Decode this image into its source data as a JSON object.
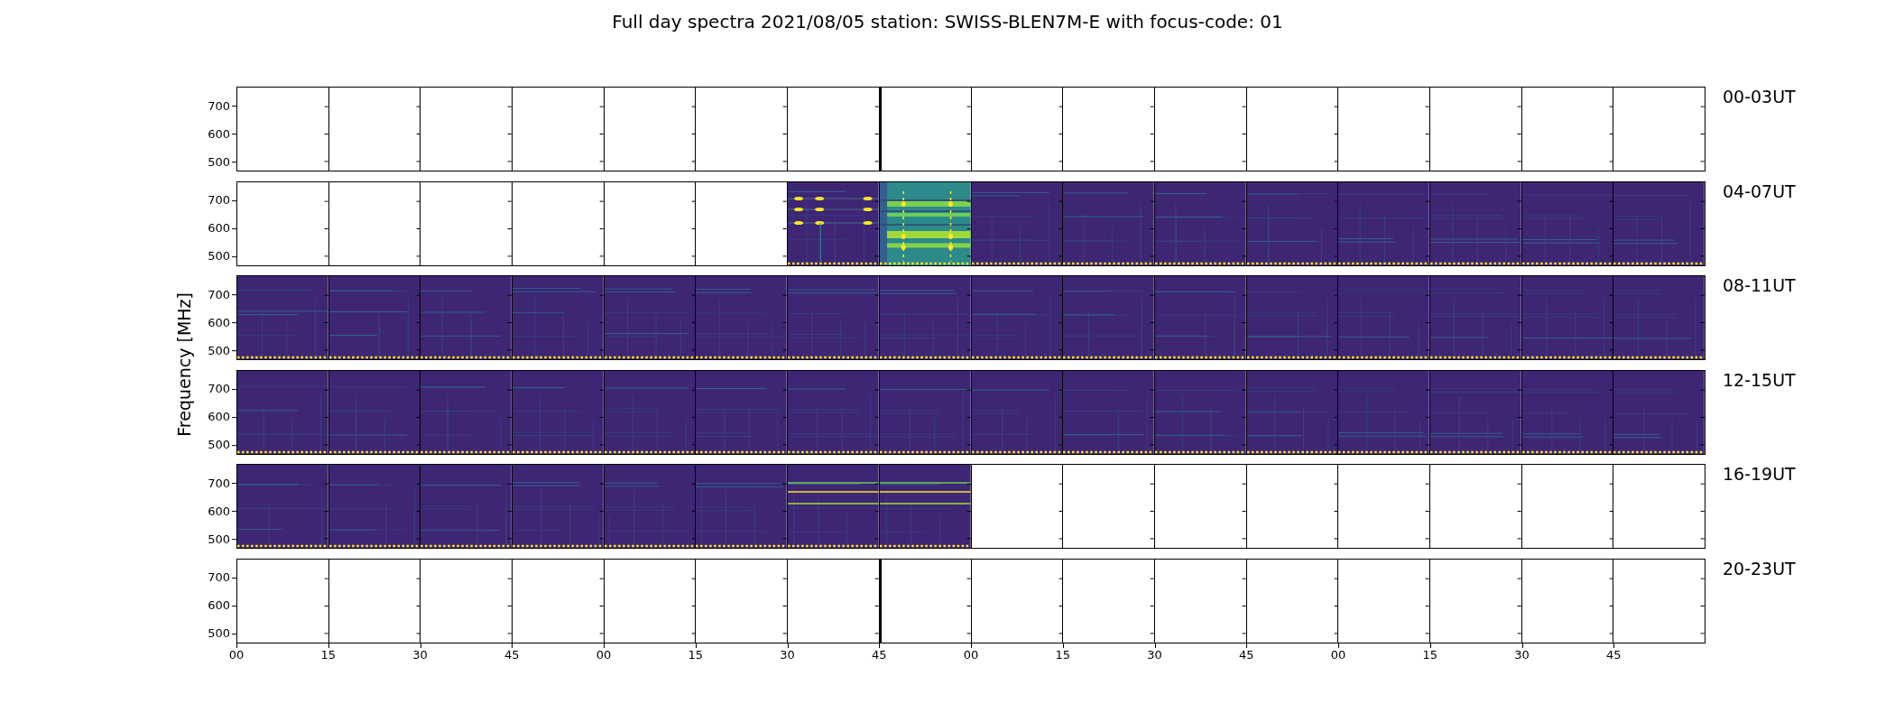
{
  "title": "Full day spectra 2021/08/05 station: SWISS-BLEN7M-E with focus-code: 01",
  "y_axis_label": "Frequency [MHz]",
  "rows": [
    {
      "label": "00-03UT",
      "yticks": [
        "700",
        "600",
        "500"
      ],
      "panels": [
        {
          "kind": "empty"
        },
        {
          "kind": "empty"
        },
        {
          "kind": "empty"
        },
        {
          "kind": "empty"
        },
        {
          "kind": "empty"
        },
        {
          "kind": "empty"
        },
        {
          "kind": "empty"
        },
        {
          "kind": "empty_marked"
        },
        {
          "kind": "empty"
        },
        {
          "kind": "empty"
        },
        {
          "kind": "empty"
        },
        {
          "kind": "empty"
        },
        {
          "kind": "empty"
        },
        {
          "kind": "empty"
        },
        {
          "kind": "empty"
        },
        {
          "kind": "empty"
        }
      ]
    },
    {
      "label": "04-07UT",
      "yticks": [
        "700",
        "600",
        "500"
      ],
      "panels": [
        {
          "kind": "empty"
        },
        {
          "kind": "empty"
        },
        {
          "kind": "empty"
        },
        {
          "kind": "empty"
        },
        {
          "kind": "empty"
        },
        {
          "kind": "empty"
        },
        {
          "kind": "bursts"
        },
        {
          "kind": "bright"
        },
        {
          "kind": "spectrum"
        },
        {
          "kind": "spectrum"
        },
        {
          "kind": "spectrum"
        },
        {
          "kind": "spectrum"
        },
        {
          "kind": "spectrum"
        },
        {
          "kind": "spectrum"
        },
        {
          "kind": "spectrum"
        },
        {
          "kind": "spectrum"
        }
      ]
    },
    {
      "label": "08-11UT",
      "yticks": [
        "700",
        "600",
        "500"
      ],
      "panels": [
        {
          "kind": "spectrum"
        },
        {
          "kind": "spectrum"
        },
        {
          "kind": "spectrum"
        },
        {
          "kind": "spectrum"
        },
        {
          "kind": "spectrum"
        },
        {
          "kind": "spectrum"
        },
        {
          "kind": "spectrum"
        },
        {
          "kind": "spectrum"
        },
        {
          "kind": "spectrum"
        },
        {
          "kind": "spectrum"
        },
        {
          "kind": "spectrum"
        },
        {
          "kind": "spectrum"
        },
        {
          "kind": "spectrum"
        },
        {
          "kind": "spectrum"
        },
        {
          "kind": "spectrum"
        },
        {
          "kind": "spectrum"
        }
      ]
    },
    {
      "label": "12-15UT",
      "yticks": [
        "700",
        "600",
        "500"
      ],
      "panels": [
        {
          "kind": "spectrum"
        },
        {
          "kind": "spectrum"
        },
        {
          "kind": "spectrum"
        },
        {
          "kind": "spectrum"
        },
        {
          "kind": "spectrum"
        },
        {
          "kind": "spectrum"
        },
        {
          "kind": "spectrum"
        },
        {
          "kind": "spectrum"
        },
        {
          "kind": "spectrum"
        },
        {
          "kind": "spectrum"
        },
        {
          "kind": "spectrum"
        },
        {
          "kind": "spectrum"
        },
        {
          "kind": "spectrum"
        },
        {
          "kind": "spectrum"
        },
        {
          "kind": "spectrum"
        },
        {
          "kind": "spectrum"
        }
      ]
    },
    {
      "label": "16-19UT",
      "yticks": [
        "700",
        "600",
        "500"
      ],
      "panels": [
        {
          "kind": "spectrum"
        },
        {
          "kind": "spectrum"
        },
        {
          "kind": "spectrum"
        },
        {
          "kind": "spectrum"
        },
        {
          "kind": "spectrum"
        },
        {
          "kind": "spectrum"
        },
        {
          "kind": "lines"
        },
        {
          "kind": "lines"
        },
        {
          "kind": "empty"
        },
        {
          "kind": "empty"
        },
        {
          "kind": "empty"
        },
        {
          "kind": "empty"
        },
        {
          "kind": "empty"
        },
        {
          "kind": "empty"
        },
        {
          "kind": "empty"
        },
        {
          "kind": "empty"
        }
      ]
    },
    {
      "label": "20-23UT",
      "yticks": [
        "700",
        "600",
        "500"
      ],
      "panels": [
        {
          "kind": "empty"
        },
        {
          "kind": "empty"
        },
        {
          "kind": "empty"
        },
        {
          "kind": "empty"
        },
        {
          "kind": "empty"
        },
        {
          "kind": "empty"
        },
        {
          "kind": "empty"
        },
        {
          "kind": "empty_marked"
        },
        {
          "kind": "empty"
        },
        {
          "kind": "empty"
        },
        {
          "kind": "empty"
        },
        {
          "kind": "empty"
        },
        {
          "kind": "empty"
        },
        {
          "kind": "empty"
        },
        {
          "kind": "empty"
        },
        {
          "kind": "empty"
        }
      ]
    }
  ],
  "xticks": [
    "00",
    "15",
    "30",
    "45",
    "00",
    "15",
    "30",
    "45",
    "00",
    "15",
    "30",
    "45",
    "00",
    "15",
    "30",
    "45"
  ]
}
